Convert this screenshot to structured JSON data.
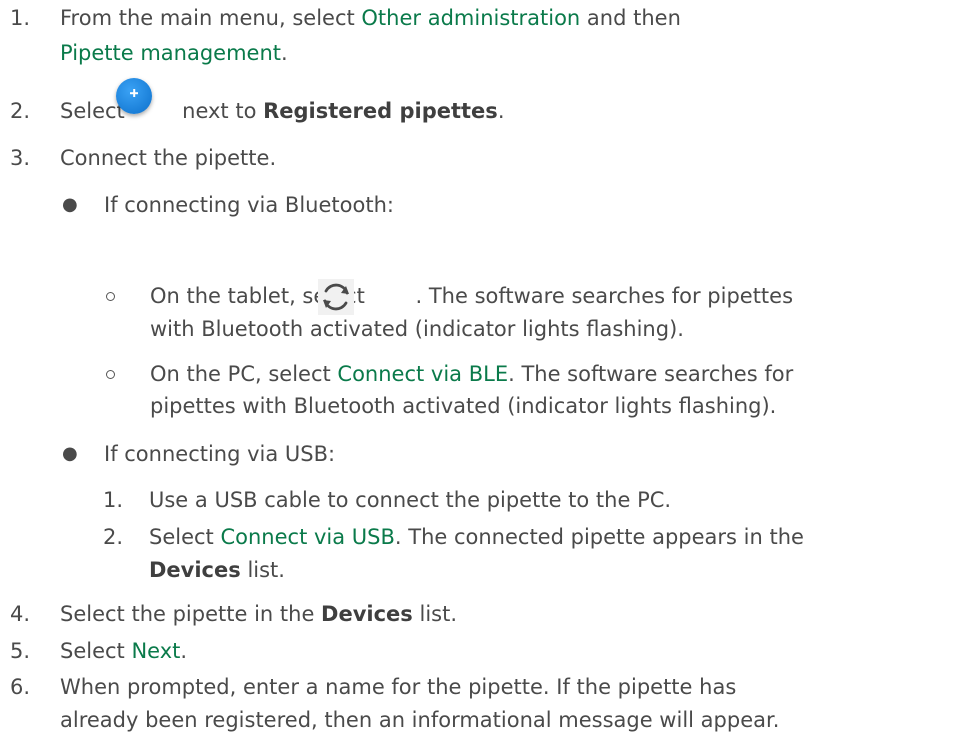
{
  "steps": {
    "s1": {
      "num": "1.",
      "t1": "From the main menu, select ",
      "link1": "Other administration",
      "t2": " and then",
      "link2": "Pipette management",
      "t3": "."
    },
    "s2": {
      "num": "2.",
      "t1": "Select ",
      "t2": " next to ",
      "bold1": "Registered pipettes",
      "t3": "."
    },
    "s3": {
      "num": "3.",
      "t1": "Connect the pipette."
    },
    "bt": {
      "bullet": "●",
      "text": "If connecting via Bluetooth:",
      "tablet": {
        "t1": "On the tablet, select ",
        "t2": ". The software searches for pipettes",
        "line2": "with Bluetooth activated (indicator lights flashing)."
      },
      "pc": {
        "t1": "On the PC, select ",
        "link1": "Connect via BLE",
        "t2": ". The software searches for",
        "line2": "pipettes with Bluetooth activated (indicator lights flashing)."
      }
    },
    "usb": {
      "bullet": "●",
      "text": "If connecting via USB:",
      "u1": {
        "num": "1.",
        "text": "Use a USB cable to connect the pipette to the PC."
      },
      "u2": {
        "num": "2.",
        "t1": "Select ",
        "link1": "Connect via USB",
        "t2": ". The connected pipette appears in the",
        "bold1": "Devices",
        "t3": " list."
      }
    },
    "s4": {
      "num": "4.",
      "t1": "Select the pipette in the ",
      "bold1": "Devices",
      "t2": " list."
    },
    "s5": {
      "num": "5.",
      "t1": "Select ",
      "link1": "Next",
      "t2": "."
    },
    "s6": {
      "num": "6.",
      "line1": "When prompted, enter a name for the pipette. If the pipette has",
      "line2": "already been registered, then an informational message will appear."
    }
  },
  "icons": {
    "add": "plus-circle-icon",
    "refresh": "refresh-icon"
  },
  "colors": {
    "link": "#0a7a4a",
    "text": "#4a4a4a",
    "icon_blue": "#1a7fd8"
  }
}
